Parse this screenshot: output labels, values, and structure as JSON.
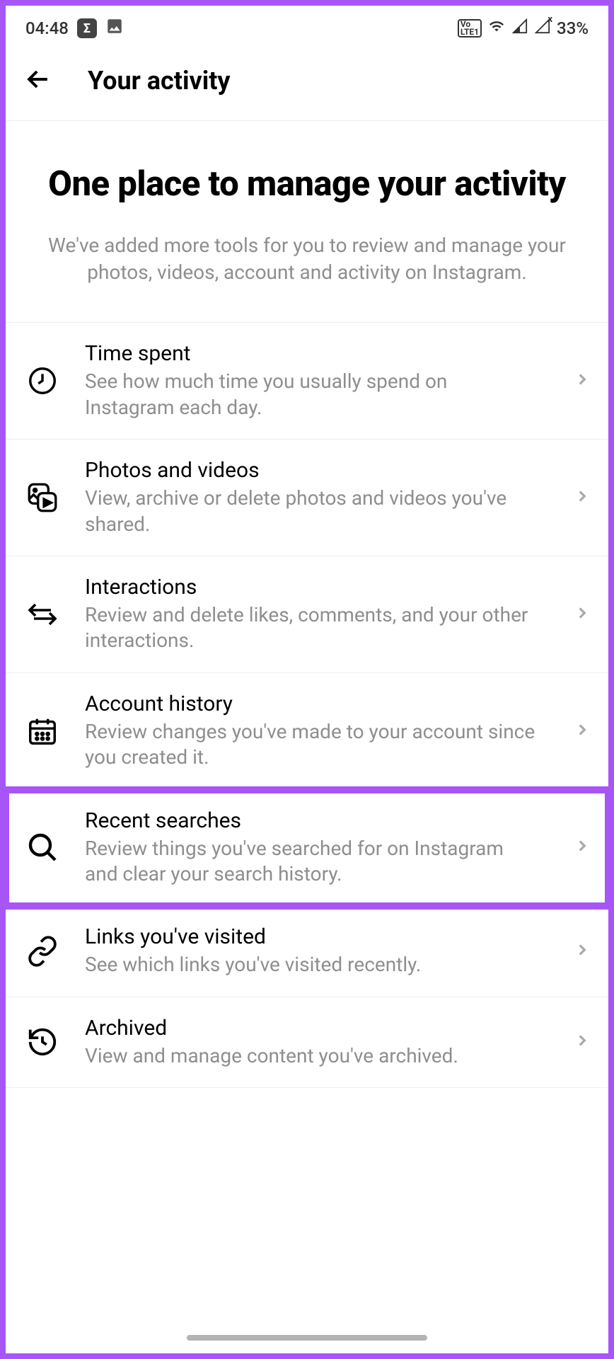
{
  "status": {
    "time": "04:48",
    "battery": "33%"
  },
  "header": {
    "title": "Your activity"
  },
  "intro": {
    "title": "One place to manage your activity",
    "description": "We've added more tools for you to review and manage your photos, videos, account and activity on Instagram."
  },
  "items": [
    {
      "title": "Time spent",
      "description": "See how much time you usually spend on Instagram each day."
    },
    {
      "title": "Photos and videos",
      "description": "View, archive or delete photos and videos you've shared."
    },
    {
      "title": "Interactions",
      "description": "Review and delete likes, comments, and your other interactions."
    },
    {
      "title": "Account history",
      "description": "Review changes you've made to your account since you created it."
    },
    {
      "title": "Recent searches",
      "description": "Review things you've searched for on Instagram and clear your search history."
    },
    {
      "title": "Links you've visited",
      "description": "See which links you've visited recently."
    },
    {
      "title": "Archived",
      "description": "View and manage content you've archived."
    }
  ]
}
